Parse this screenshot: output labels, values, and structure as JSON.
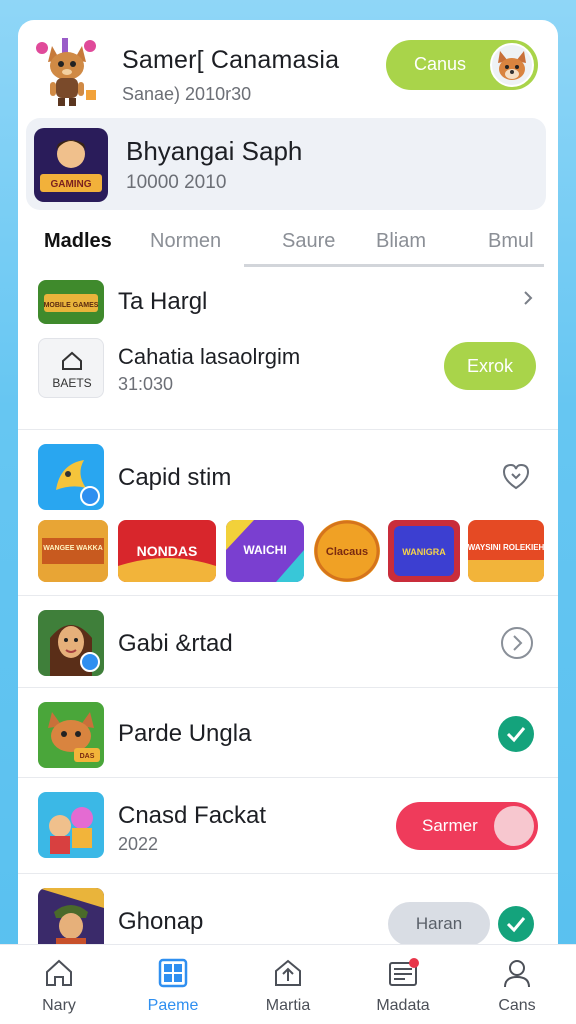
{
  "header": {
    "title": "Samer[ Canamasia",
    "subtitle": "Sanae) 2010r30",
    "toggle_label": "Canus",
    "avatar_icon": "fox-character-icon",
    "profile_icon": "fox-avatar-icon"
  },
  "featured": {
    "title": "Bhyangai Saph",
    "subtitle": "10000 2010",
    "thumb_text": "GAMING"
  },
  "tabs": [
    {
      "label": "Madles",
      "active": true
    },
    {
      "label": "Normen",
      "active": false
    },
    {
      "label": "Saure",
      "active": false
    },
    {
      "label": "Bliam",
      "active": false
    },
    {
      "label": "Bmul",
      "active": false
    }
  ],
  "list": {
    "row1": {
      "title": "Ta Hargl",
      "thumb_text": "MOBILE GAMES"
    },
    "row2": {
      "title": "Cahatia lasaolrgim",
      "subtitle": "31:030",
      "button": "Exrok",
      "thumb_text": "BAETS"
    },
    "row3": {
      "title": "Capid stim"
    },
    "strip": [
      "WANGEE WAKKA",
      "NONDAS",
      "WAICHI",
      "Clacaus",
      "WANIGRA",
      "WAYSINI ROLEKIEH"
    ],
    "row4": {
      "title": "Gabi &rtad"
    },
    "row5": {
      "title": "Parde Ungla",
      "thumb_text": "DAS"
    },
    "row6": {
      "title": "Cnasd Fackat",
      "subtitle": "2022",
      "button": "Sarmer"
    },
    "row7": {
      "title": "Ghonap",
      "button": "Haran"
    }
  },
  "bottom_nav": [
    {
      "label": "Nary",
      "icon": "home-icon"
    },
    {
      "label": "Paeme",
      "icon": "grid-icon",
      "active": true
    },
    {
      "label": "Martia",
      "icon": "upload-icon"
    },
    {
      "label": "Madata",
      "icon": "message-icon"
    },
    {
      "label": "Cans",
      "icon": "person-icon"
    }
  ],
  "colors": {
    "accent_green": "#a9d44a",
    "accent_red": "#ef3b5b",
    "check_teal": "#14a37c",
    "nav_active": "#2f8ff0"
  }
}
